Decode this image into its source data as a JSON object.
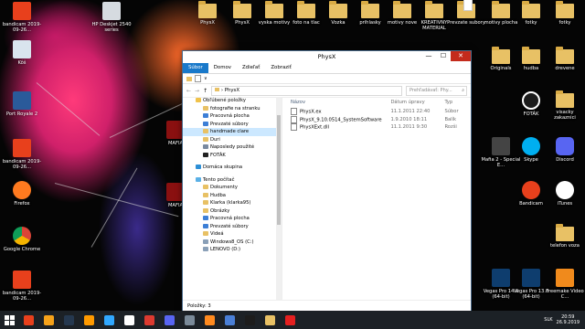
{
  "desktop": {
    "top_icons": [
      "PhysX",
      "PhysX",
      "vyska motivy",
      "foto na tlac",
      "Vozka",
      "prihlasky",
      "motivy nove",
      "KREATIVNY MATERIAL",
      "Prevzate subory",
      "motivy plocha",
      "fotky",
      "fotky"
    ],
    "left_icons": [
      "bandicam 2019-09-26...",
      "Kôš",
      "Port Royale 2",
      "bandicam 2019-09-26...",
      "Firefox",
      "Google Chrome",
      "bandicam 2019-09-26..."
    ],
    "second_col_icons": [
      "HP Deskjet 2540 series",
      "MAFIA",
      "MAFIA"
    ],
    "right_icons": [
      "motivy plocha",
      "fotky",
      "fotky",
      "Originals",
      "hudba",
      "drevene",
      "FOTÁK",
      "visacky zakaznici",
      "Mafia 2 - Special E...",
      "Skype",
      "Discord",
      "Bandicam",
      "iTunes",
      "telefon voza",
      "Vegas Pro 14.0 (64-bit)",
      "Vegas Pro 13.0 (64-bit)",
      "Freemake Video C..."
    ]
  },
  "window": {
    "title": "PhysX",
    "controls": {
      "min": "—",
      "max": "☐",
      "close": "✕"
    },
    "ribbon_tabs": [
      "Súbor",
      "Domov",
      "Zdieľať",
      "Zobraziť"
    ],
    "qa_chevron": "∨",
    "address": {
      "back": "←",
      "forward": "→",
      "up": "↑",
      "path_sep": "›",
      "path": "PhysX",
      "search_placeholder": "Prehľadávať: Phy...",
      "search_glyph": "⌕"
    },
    "nav": [
      {
        "label": "Obľúbené položky",
        "level": 0,
        "icon_color": "#f0c24a",
        "selected": false
      },
      {
        "label": "fotografie na stranku",
        "level": 1,
        "icon_color": "#e8c165",
        "selected": false
      },
      {
        "label": "Pracovná plocha",
        "level": 1,
        "icon_color": "#3d7fd6",
        "selected": false
      },
      {
        "label": "Prevzaté súbory",
        "level": 1,
        "icon_color": "#3d7fd6",
        "selected": false
      },
      {
        "label": "handmade clare",
        "level": 1,
        "icon_color": "#e8c165",
        "selected": true
      },
      {
        "label": "Duri",
        "level": 1,
        "icon_color": "#e8c165",
        "selected": false
      },
      {
        "label": "Naposledy použité",
        "level": 1,
        "icon_color": "#7a8aa0",
        "selected": false
      },
      {
        "label": "FOTÁK",
        "level": 1,
        "icon_color": "#222222",
        "selected": false
      },
      {
        "gap": true
      },
      {
        "label": "Domáca skupina",
        "level": 0,
        "icon_color": "#2d8fd6",
        "selected": false
      },
      {
        "gap": true
      },
      {
        "label": "Tento počítač",
        "level": 0,
        "icon_color": "#5ab0e6",
        "selected": false
      },
      {
        "label": "Dokumenty",
        "level": 1,
        "icon_color": "#e8c165",
        "selected": false
      },
      {
        "label": "Hudba",
        "level": 1,
        "icon_color": "#e8c165",
        "selected": false
      },
      {
        "label": "Klarka (klarka95)",
        "level": 1,
        "icon_color": "#e8c165",
        "selected": false
      },
      {
        "label": "Obrázky",
        "level": 1,
        "icon_color": "#e8c165",
        "selected": false
      },
      {
        "label": "Pracovná plocha",
        "level": 1,
        "icon_color": "#3d7fd6",
        "selected": false
      },
      {
        "label": "Prevzaté súbory",
        "level": 1,
        "icon_color": "#3d7fd6",
        "selected": false
      },
      {
        "label": "Videá",
        "level": 1,
        "icon_color": "#e8c165",
        "selected": false
      },
      {
        "label": "Windows8_OS (C:)",
        "level": 1,
        "icon_color": "#8aa0b8",
        "selected": false
      },
      {
        "label": "LENOVO (D:)",
        "level": 1,
        "icon_color": "#8aa0b8",
        "selected": false
      }
    ],
    "columns": [
      "Názov",
      "Dátum úpravy",
      "Typ"
    ],
    "files": [
      {
        "name": "PhysX.ex",
        "date": "11.1.2011 22:40",
        "type": "Súbor"
      },
      {
        "name": "PhysX_9.10.0514_SystemSoftware",
        "date": "1.9.2010 18:11",
        "type": "Balík"
      },
      {
        "name": "PhysXExt.dll",
        "date": "11.1.2011 9:30",
        "type": "Rozši"
      }
    ],
    "status": "Položky: 3"
  },
  "taskbar": {
    "lang": "SLK",
    "time": "20:59",
    "date": "26.9.2019",
    "apps": [
      "#e8401c",
      "#f6a21a",
      "#25384f",
      "#ff9a00",
      "#31a8ff",
      "#ffffff",
      "#dc3a30",
      "#5865f2",
      "#7a8a99",
      "#ff8a1f",
      "#4a7fd6",
      "#1c1c1c",
      "#e8c165",
      "#e42020"
    ]
  }
}
